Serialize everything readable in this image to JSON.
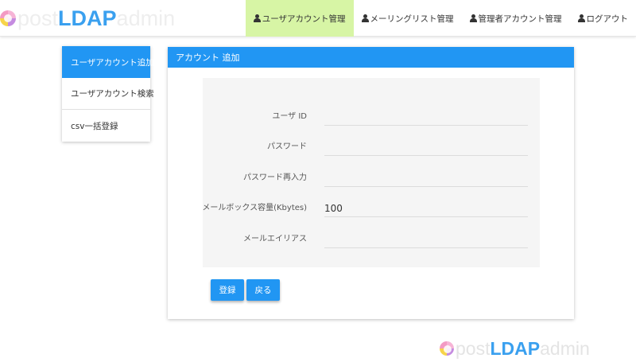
{
  "brand": {
    "post": "post",
    "ldap": "LDAP",
    "admin": "admin"
  },
  "nav": {
    "items": [
      {
        "label": "ユーザアカウント管理",
        "icon": "user-icon",
        "active": true
      },
      {
        "label": "メーリングリスト管理",
        "icon": "user-icon",
        "active": false
      },
      {
        "label": "管理者アカウント管理",
        "icon": "user-icon",
        "active": false
      },
      {
        "label": "ログアウト",
        "icon": "user-icon",
        "active": false
      }
    ]
  },
  "sidebar": {
    "items": [
      {
        "label": "ユーザアカウント追加",
        "active": true
      },
      {
        "label": "ユーザアカウント検索",
        "active": false
      },
      {
        "label": "csv一括登録",
        "active": false
      }
    ]
  },
  "panel": {
    "title": "アカウント 追加",
    "fields": [
      {
        "label": "ユーザ ID",
        "value": ""
      },
      {
        "label": "パスワード",
        "value": ""
      },
      {
        "label": "パスワード再入力",
        "value": ""
      },
      {
        "label": "メールボックス容量(Kbytes)",
        "value": "100"
      },
      {
        "label": "メールエイリアス",
        "value": ""
      }
    ],
    "buttons": {
      "register": "登録",
      "back": "戻る"
    }
  },
  "colors": {
    "accent": "#2196f3",
    "nav_active": "#d7f5a5",
    "brand_ldap": "#3aa0ef"
  }
}
